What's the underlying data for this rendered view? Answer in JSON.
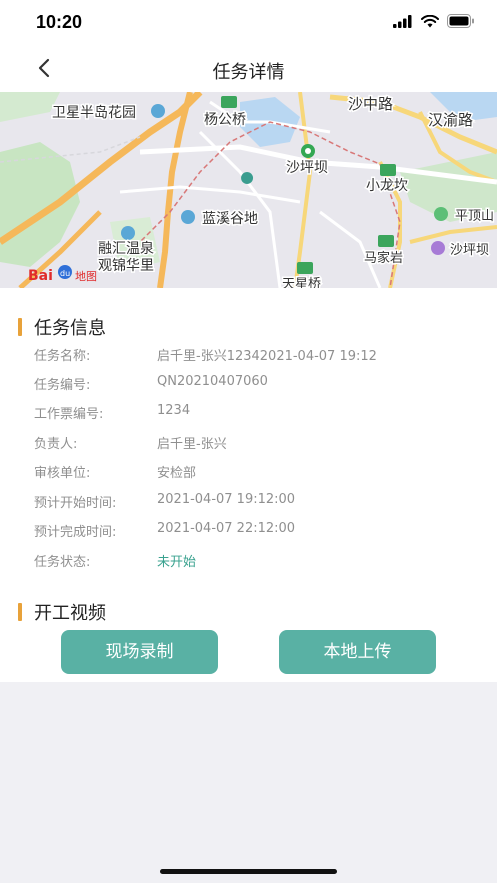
{
  "status_bar": {
    "time": "10:20"
  },
  "header": {
    "title": "任务详情"
  },
  "map": {
    "labels": {
      "weixing": "卫星半岛花园",
      "yanggong": "杨公桥",
      "shazhong": "沙中路",
      "hanyu": "汉渝路",
      "shapingba_station": "沙坪坝",
      "xiaolongkan": "小龙坎",
      "lanxi": "蓝溪谷地",
      "pingdingshan": "平顶山",
      "shapingba_park": "沙坪坝",
      "ronghui": "融汇温泉",
      "guanjin": "观锦华里",
      "majiayan": "马家岩",
      "tianxing": "天星桥"
    },
    "logo": {
      "baidu": "Bai",
      "du": "du",
      "suffix": "地图"
    }
  },
  "task_info": {
    "section_title": "任务信息",
    "rows": [
      {
        "label": "任务名称:",
        "value": "启千里-张兴12342021-04-07 19:12"
      },
      {
        "label": "任务编号:",
        "value": "QN20210407060"
      },
      {
        "label": "工作票编号:",
        "value": "1234"
      },
      {
        "label": "负责人:",
        "value": "启千里-张兴"
      },
      {
        "label": "审核单位:",
        "value": "安检部"
      },
      {
        "label": "预计开始时间:",
        "value": "2021-04-07 19:12:00"
      },
      {
        "label": "预计完成时间:",
        "value": "2021-04-07 22:12:00"
      },
      {
        "label": "任务状态:",
        "value": "未开始"
      }
    ],
    "status_color": "#3aa28f"
  },
  "video": {
    "section_title": "开工视频",
    "record_button": "现场录制",
    "upload_button": "本地上传"
  },
  "colors": {
    "accent": "#59b1a4",
    "section_bar": "#e8a23a"
  }
}
